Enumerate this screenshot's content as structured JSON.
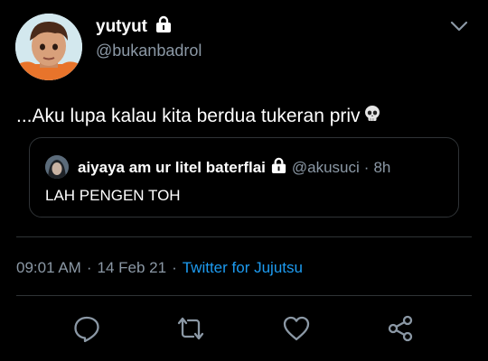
{
  "author": {
    "display_name": "yutyut",
    "handle": "@bukanbadrol",
    "protected": true
  },
  "tweet": {
    "text": "...Aku lupa kalau kita berdua tukeran priv",
    "emoji": "skull-icon"
  },
  "quoted": {
    "display_name": "aiyaya am ur litel baterflai",
    "handle": "@akusuci",
    "separator": "·",
    "time": "8h",
    "text": "LAH PENGEN TOH",
    "protected": true
  },
  "meta": {
    "time": "09:01 AM",
    "sep1": "·",
    "date": "14 Feb 21",
    "sep2": "·",
    "source": "Twitter for Jujutsu"
  },
  "actions": [
    "reply-icon",
    "retweet-icon",
    "like-icon",
    "share-icon"
  ],
  "colors": {
    "background": "#000000",
    "text": "#ffffff",
    "secondary": "#8b98a5",
    "accent": "#1d9bf0",
    "border": "#2f3336"
  }
}
